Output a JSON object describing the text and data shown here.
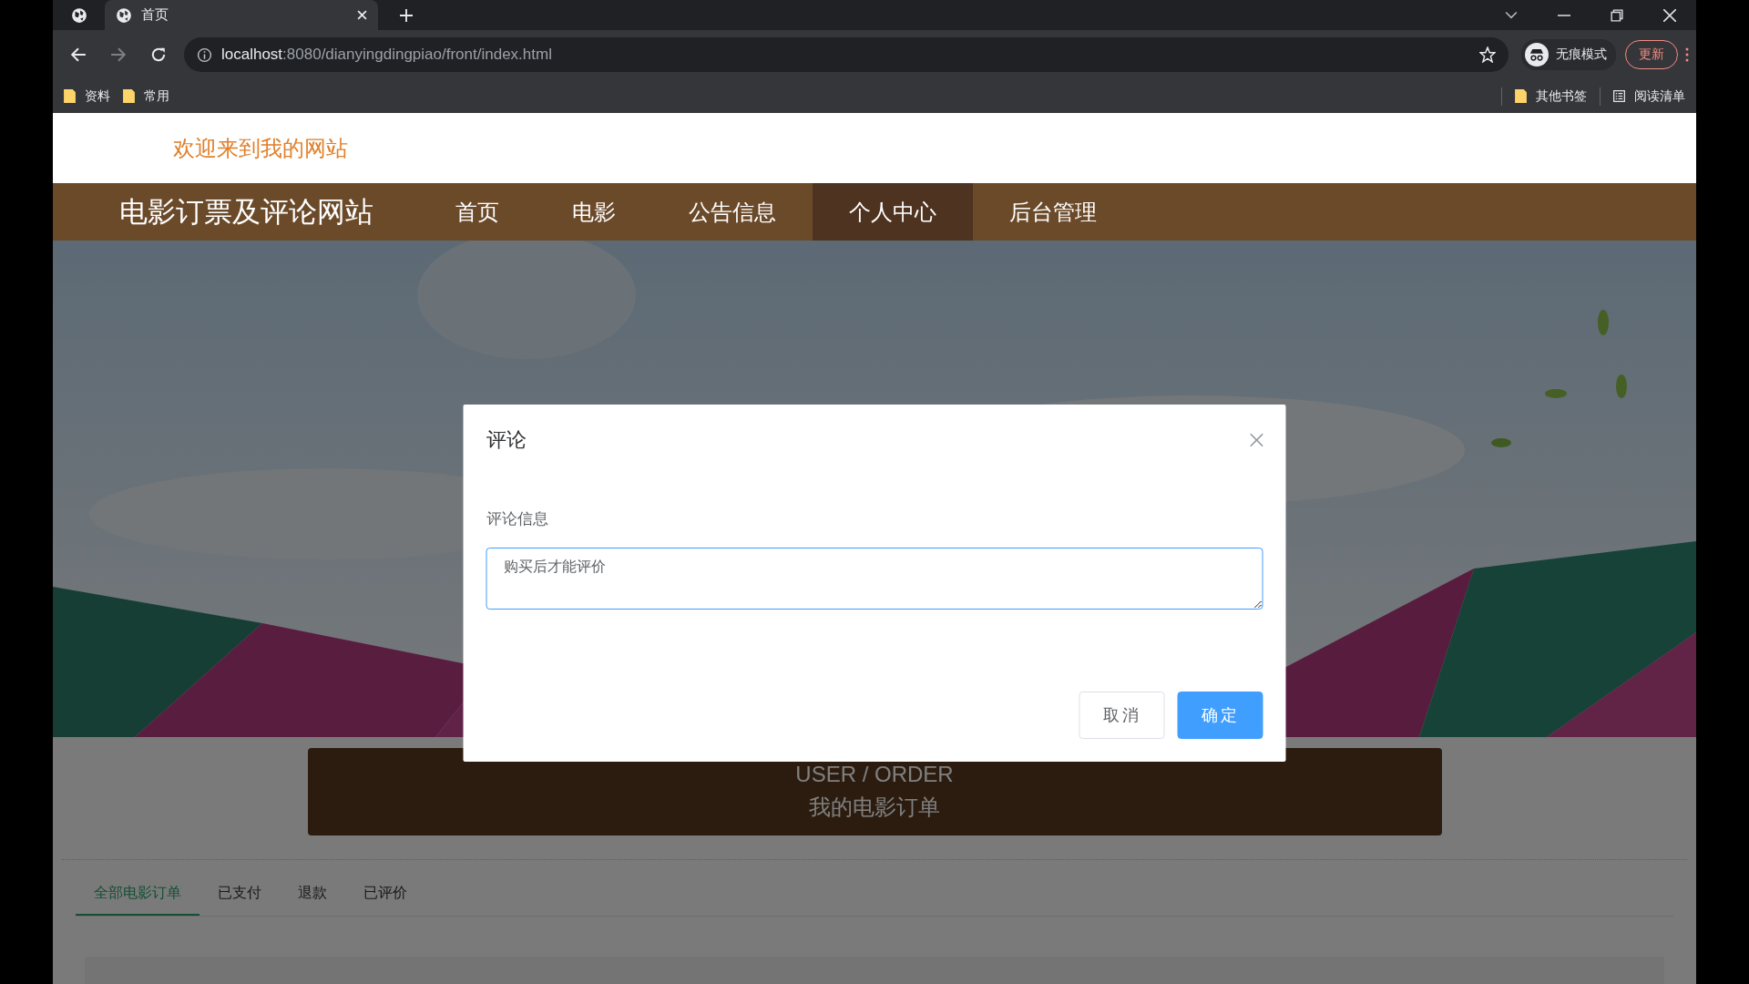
{
  "browser": {
    "tabs": [
      {
        "kind": "pinned",
        "selected": false
      },
      {
        "kind": "normal",
        "title": "首页",
        "selected": true
      }
    ],
    "url_host": "localhost",
    "url_path": ":8080/dianyingdingpiao/front/index.html",
    "bookmarks": [
      "资料",
      "常用"
    ],
    "profile": "无痕模式",
    "update_button": "更新",
    "other_bookmarks": "其他书签",
    "reading_list": "阅读清单"
  },
  "site": {
    "welcome": "欢迎来到我的网站",
    "brand": "电影订票及评论网站",
    "nav": [
      {
        "label": "首页",
        "selected": false
      },
      {
        "label": "电影",
        "selected": false
      },
      {
        "label": "公告信息",
        "selected": false
      },
      {
        "label": "个人中心",
        "selected": true
      },
      {
        "label": "后台管理",
        "selected": false
      }
    ]
  },
  "order_banner": {
    "title_en": "USER / ORDER",
    "title": "我的电影订单"
  },
  "order_tabs": [
    {
      "label": "全部电影订单",
      "selected": true
    },
    {
      "label": "已支付",
      "selected": false
    },
    {
      "label": "退款",
      "selected": false
    },
    {
      "label": "已评价",
      "selected": false
    }
  ],
  "dialog": {
    "title": "评论",
    "field_label": "评论信息",
    "value": "购买后才能评价",
    "buttons": [
      {
        "label": "取消",
        "kind": "default"
      },
      {
        "label": "确定",
        "kind": "primary"
      }
    ]
  }
}
